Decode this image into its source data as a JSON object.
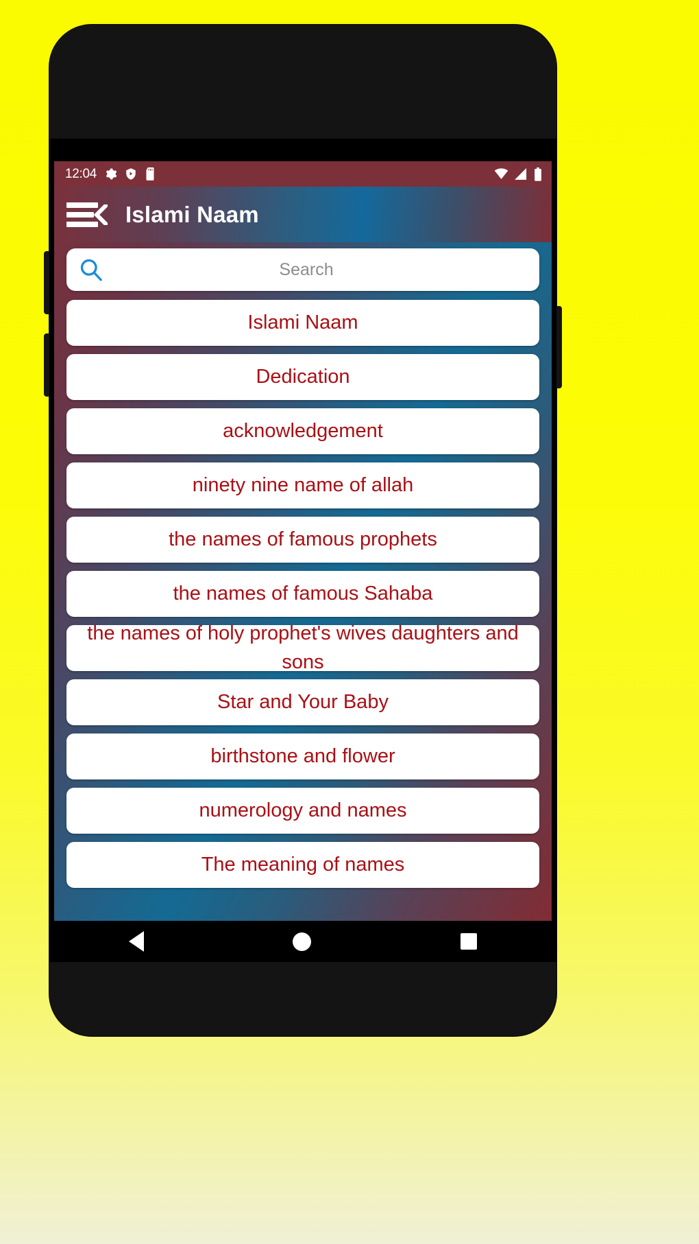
{
  "statusbar": {
    "time": "12:04",
    "left_icons": [
      "gear-icon",
      "shield-play-icon",
      "sd-card-icon"
    ],
    "right_icons": [
      "wifi-icon",
      "signal-icon",
      "battery-icon"
    ]
  },
  "appbar": {
    "menu_icon": "hamburger-back-icon",
    "title": "Islami Naam"
  },
  "search": {
    "icon": "search-icon",
    "placeholder": "Search",
    "value": ""
  },
  "list": {
    "items": [
      {
        "label": "Islami Naam"
      },
      {
        "label": "Dedication"
      },
      {
        "label": "acknowledgement"
      },
      {
        "label": "ninety nine name of allah"
      },
      {
        "label": "the names of famous prophets"
      },
      {
        "label": "the names of famous Sahaba"
      },
      {
        "label": "the names of holy prophet's wives daughters and sons"
      },
      {
        "label": "Star and Your Baby"
      },
      {
        "label": "birthstone and flower"
      },
      {
        "label": "numerology and names"
      },
      {
        "label": "The meaning of names"
      }
    ]
  },
  "navbar": {
    "back_label": "back-button",
    "home_label": "home-button",
    "recents_label": "recents-button"
  },
  "colors": {
    "accent_red": "#A91015",
    "appbar_red": "#7C3039",
    "appbar_blue": "#14699C",
    "backdrop_yellow": "#FCFC00",
    "search_icon_blue": "#1C8DD6"
  }
}
